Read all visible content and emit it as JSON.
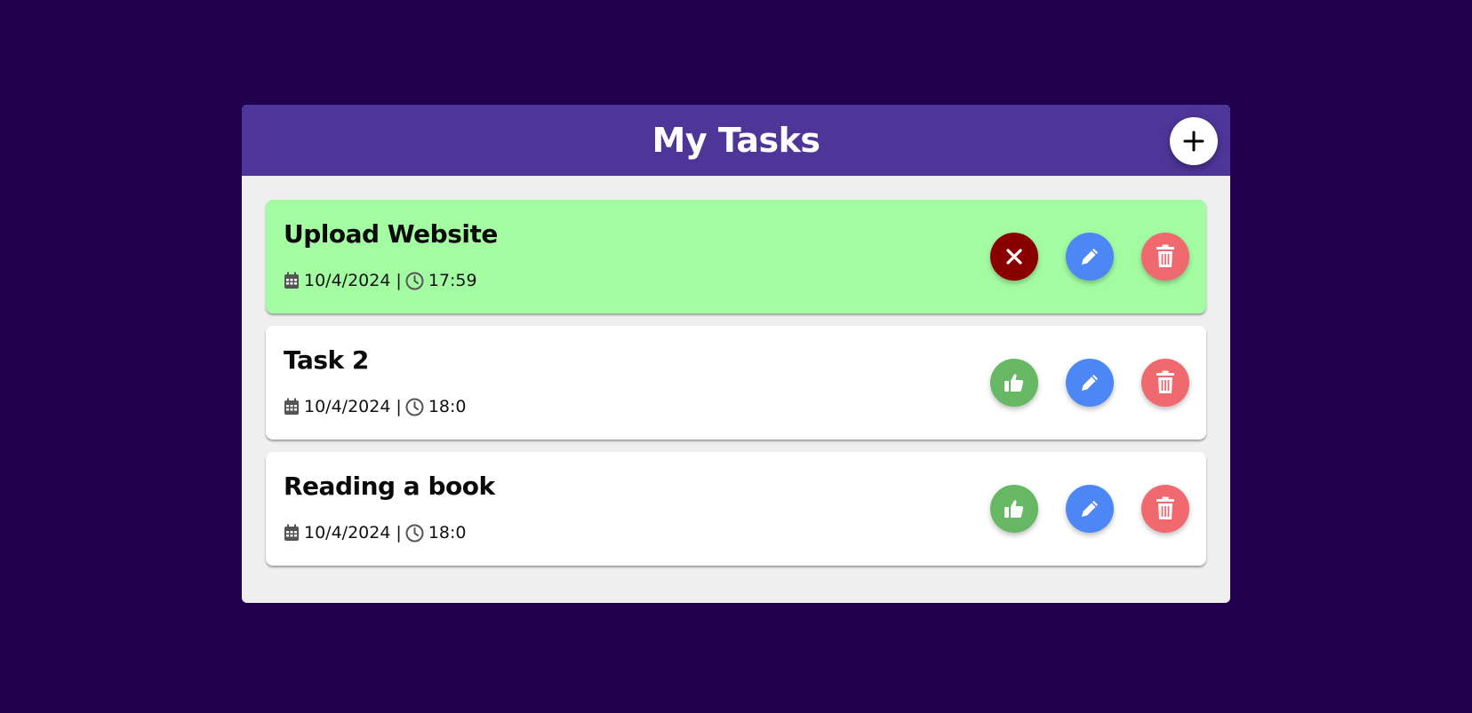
{
  "header": {
    "title": "My Tasks"
  },
  "colors": {
    "page_background": "#21004f",
    "header": "#4e3598",
    "panel": "#efefef",
    "done_card": "#a4fca2",
    "undo": "#8a0000",
    "complete": "#66b864",
    "edit": "#4d86f5",
    "delete": "#f0696e"
  },
  "tasks": [
    {
      "title": "Upload Website",
      "date": "10/4/2024",
      "separator": "|",
      "time": "17:59",
      "status": "done",
      "status_action_icon": "x-icon"
    },
    {
      "title": "Task 2",
      "date": "10/4/2024",
      "separator": "|",
      "time": "18:0",
      "status": "pending",
      "status_action_icon": "thumbs-up-icon"
    },
    {
      "title": "Reading a book",
      "date": "10/4/2024",
      "separator": "|",
      "time": "18:0",
      "status": "pending",
      "status_action_icon": "thumbs-up-icon"
    }
  ],
  "icons": {
    "add": "plus-icon",
    "date": "calendar-icon",
    "time": "clock-icon",
    "edit": "pencil-icon",
    "delete": "trash-icon"
  }
}
